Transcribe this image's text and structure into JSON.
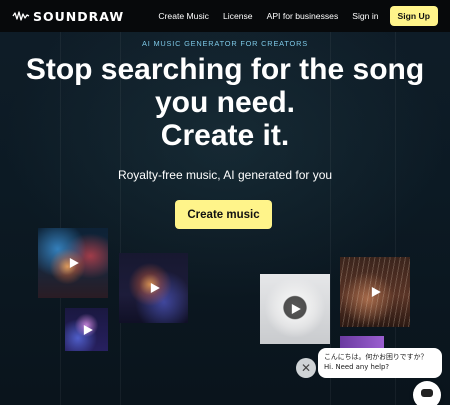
{
  "nav": {
    "logo_text": "SOUNDRAW",
    "links": [
      "Create Music",
      "License",
      "API for businesses",
      "Sign in"
    ],
    "signup_label": "Sign Up"
  },
  "hero": {
    "eyebrow": "AI MUSIC GENERATOR FOR CREATORS",
    "headline_line1": "Stop searching for the song",
    "headline_line2": "you need.",
    "headline_line3": "Create it.",
    "subhead": "Royalty-free music, AI generated for you",
    "cta_label": "Create music"
  },
  "thumbnails": [
    {
      "name": "concert-crowd"
    },
    {
      "name": "performer-lights"
    },
    {
      "name": "purple-stage"
    },
    {
      "name": "floating-figure"
    },
    {
      "name": "piano-hands"
    },
    {
      "name": "purple-partial"
    }
  ],
  "chat": {
    "close_icon": "close-icon",
    "message": "こんにちは。何かお困りですか？Hi. Need any help?",
    "launcher_icon": "chat-icon"
  },
  "colors": {
    "accent": "#fff48a",
    "eyebrow": "#7dc8e6",
    "nav_bg": "#07090b",
    "page_bg": "#0d1822"
  }
}
